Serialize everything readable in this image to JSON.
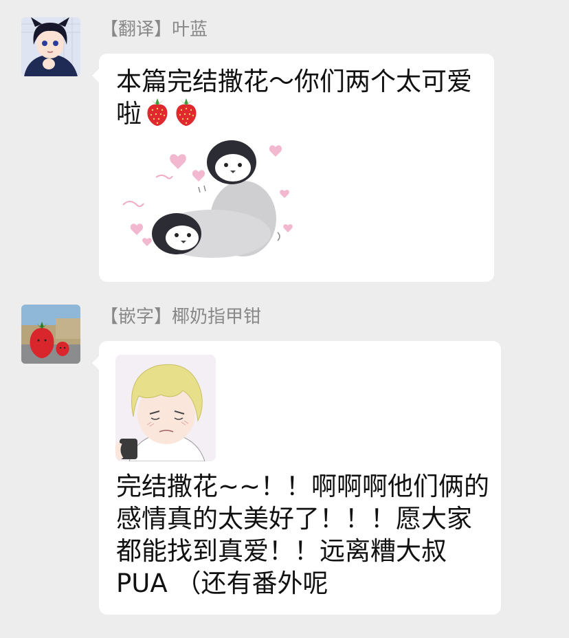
{
  "messages": [
    {
      "sender": "【翻译】叶蓝",
      "avatar_icon": "anime-girl-avatar-icon",
      "text": "本篇完结撒花～你们两个太可爱啦",
      "emojis": [
        "strawberry-emoji",
        "strawberry-emoji"
      ],
      "sticker_icon": "penguin-sticker-icon"
    },
    {
      "sender": "【嵌字】椰奶指甲钳",
      "avatar_icon": "strawberry-avatar-icon",
      "sticker_icon": "blonde-anime-boy-sticker-icon",
      "text": "完结撒花~~！！啊啊啊他们俩的感情真的太美好了！！！愿大家都能找到真爱！！远离糟大叔PUA （还有番外呢"
    }
  ],
  "colors": {
    "background": "#ededed",
    "bubble": "#ffffff",
    "sender_name": "#888888",
    "text": "#111111"
  }
}
